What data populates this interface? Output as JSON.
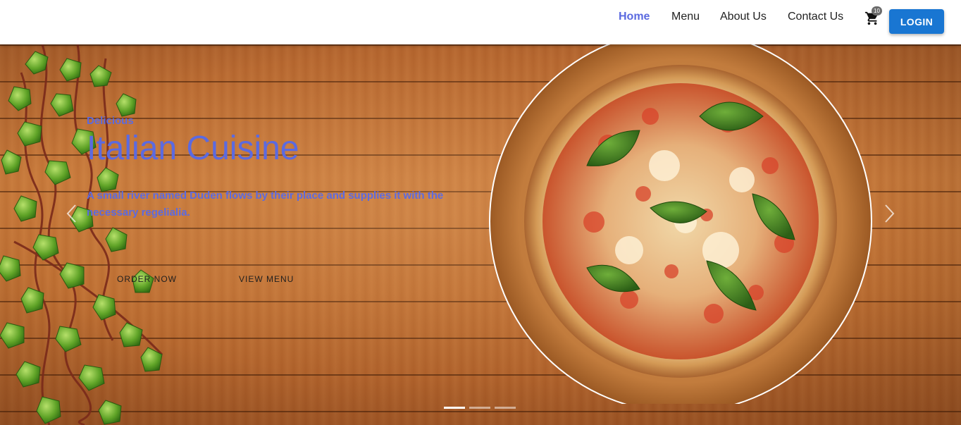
{
  "nav": {
    "links": [
      {
        "label": "Home",
        "active": true
      },
      {
        "label": "Menu",
        "active": false
      },
      {
        "label": "About Us",
        "active": false
      },
      {
        "label": "Contact Us",
        "active": false
      }
    ],
    "cart_icon": "shopping-cart-icon",
    "cart_count": "10",
    "login_label": "LOGIN"
  },
  "hero": {
    "subtitle": "Delicious",
    "title": "Italian Cuisine",
    "description": "A small river named Duden flows by their place and supplies it with the necessary regelialia.",
    "order_label": "ORDER NOW",
    "view_menu_label": "VIEW MENU",
    "prev_icon": "chevron-left-icon",
    "next_icon": "chevron-right-icon",
    "slides": 3,
    "active_slide": 1
  },
  "colors": {
    "accent": "#5b6ae0",
    "login_button": "#1976d2",
    "wood": "#c8793a"
  }
}
